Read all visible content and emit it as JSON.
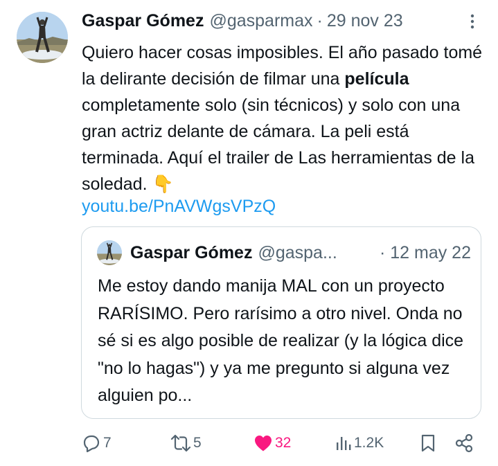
{
  "tweet": {
    "author_name": "Gaspar Gómez",
    "handle": "@gasparmax",
    "separator": "·",
    "date": "29 nov 23",
    "text_before_bold": "Quiero hacer cosas imposibles. El año pasado tomé la delirante decisión de filmar una ",
    "text_bold": "película",
    "text_after_bold": " completamente solo (sin técnicos) y solo con una gran actriz delante de cámara. La peli está terminada. Aquí el trailer de Las herramientas de la soledad. ",
    "emoji": "👇",
    "link": "youtu.be/PnAVWgsVPzQ"
  },
  "quoted": {
    "author_name": "Gaspar Gómez",
    "handle": "@gaspa...",
    "date": "· 12 may 22",
    "text": "Me estoy dando manija MAL con un proyecto RARÍSIMO. Pero rarísimo a otro nivel. Onda no sé si es algo posible de realizar (y la lógica dice \"no lo hagas\") y ya me pregunto si alguna vez alguien po..."
  },
  "actions": {
    "replies": "7",
    "retweets": "5",
    "likes": "32",
    "views": "1.2K"
  },
  "colors": {
    "text": "#0f1419",
    "secondary": "#536471",
    "link": "#1d9bf0",
    "like": "#f91880",
    "border": "#cfd9de"
  },
  "icons": [
    "avatar",
    "more-icon",
    "reply-icon",
    "retweet-icon",
    "heart-icon",
    "views-icon",
    "bookmark-icon",
    "share-icon"
  ]
}
